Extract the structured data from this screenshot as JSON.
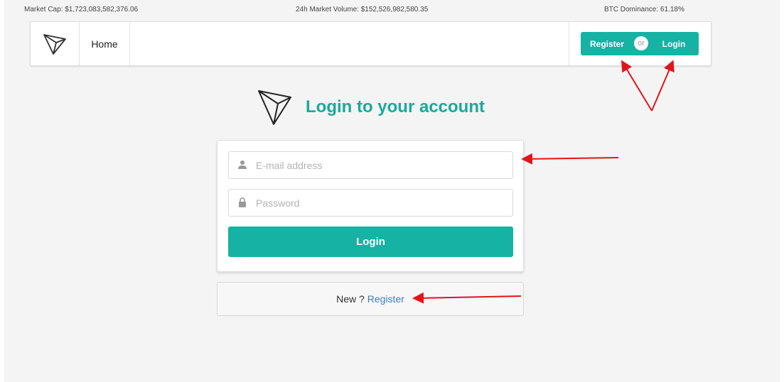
{
  "ticker": {
    "market_cap": "Market Cap: $1,723,083,582,376.06",
    "volume": "24h Market Volume: $152,526,982,580.35",
    "dominance": "BTC Dominance: 61.18%"
  },
  "nav": {
    "home": "Home",
    "register": "Register",
    "or": "or",
    "login": "Login"
  },
  "form": {
    "title": "Login to your account",
    "email_placeholder": "E-mail address",
    "password_placeholder": "Password",
    "submit_label": "Login"
  },
  "signup": {
    "prompt": "New ?",
    "link": "Register"
  },
  "colors": {
    "accent": "#16b2a4",
    "title": "#1aa99c",
    "link": "#3e7dc0",
    "annotation": "#e0151b"
  }
}
